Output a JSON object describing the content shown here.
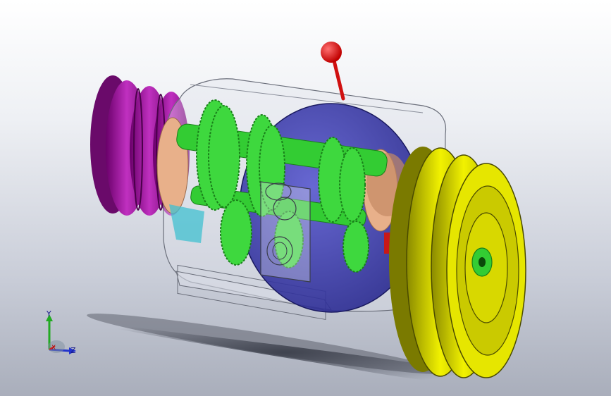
{
  "viewport": {
    "background_top": "#ffffff",
    "background_bottom": "#a9aebb"
  },
  "model": {
    "components": [
      {
        "name": "left-pulley",
        "color": "#a020a0"
      },
      {
        "name": "right-pulley",
        "color": "#e6e600"
      },
      {
        "name": "gear-shafts",
        "color": "#33cc33"
      },
      {
        "name": "inner-drum",
        "color": "#3f3fb0"
      },
      {
        "name": "bearing-collars",
        "color": "#e8b08a"
      },
      {
        "name": "shift-lever-knob",
        "color": "#e01010"
      },
      {
        "name": "transparent-housing",
        "color": "#c8ccd8"
      }
    ]
  },
  "triad": {
    "y_label": "Y",
    "z_label": "Z",
    "x_label": "X",
    "y_color": "#22aa22",
    "z_color": "#2233cc",
    "x_color": "#cc2222"
  }
}
